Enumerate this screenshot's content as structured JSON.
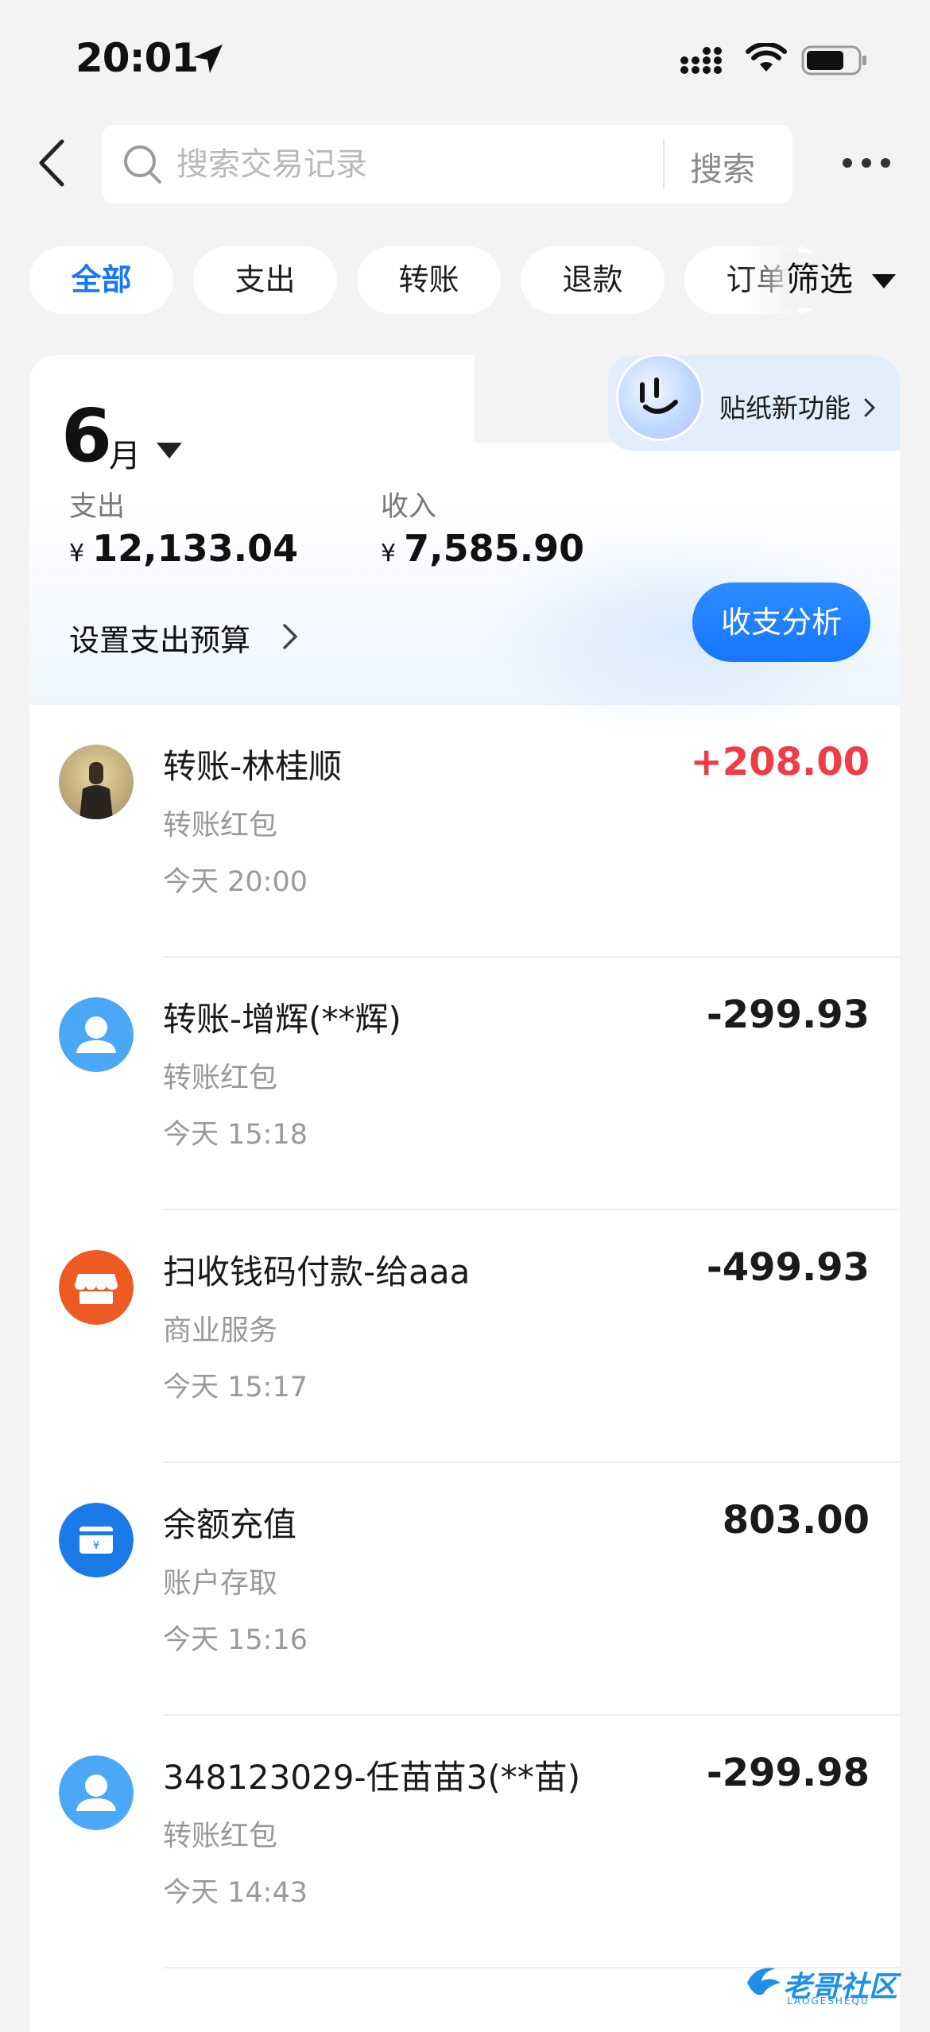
{
  "status_bar": {
    "time": "20:01"
  },
  "search": {
    "placeholder": "搜索交易记录",
    "button_label": "搜索"
  },
  "filters": {
    "chips": [
      {
        "label": "全部",
        "active": true
      },
      {
        "label": "支出",
        "active": false
      },
      {
        "label": "转账",
        "active": false
      },
      {
        "label": "退款",
        "active": false
      },
      {
        "label": "订单",
        "active": false
      }
    ],
    "filter_label": "筛选"
  },
  "summary": {
    "sticker_label": "贴纸新功能",
    "month_number": "6",
    "month_unit": "月",
    "expense_label": "支出",
    "expense_value": "12,133.04",
    "income_label": "收入",
    "income_value": "7,585.90",
    "currency": "¥",
    "budget_link": "设置支出预算",
    "analysis_button": "收支分析"
  },
  "transactions": [
    {
      "title": "转账-林桂顺",
      "category": "转账红包",
      "time": "今天 20:00",
      "amount": "+208.00",
      "icon": "user-photo-avatar"
    },
    {
      "title": "转账-增辉(**辉)",
      "category": "转账红包",
      "time": "今天 15:18",
      "amount": "-299.93",
      "icon": "person-icon"
    },
    {
      "title": "扫收钱码付款-给aaa",
      "category": "商业服务",
      "time": "今天 15:17",
      "amount": "-499.93",
      "icon": "store-icon"
    },
    {
      "title": "余额充值",
      "category": "账户存取",
      "time": "今天 15:16",
      "amount": "803.00",
      "icon": "wallet-icon"
    },
    {
      "title": "348123029-任苗苗3(**苗)",
      "category": "转账红包",
      "time": "今天 14:43",
      "amount": "-299.98",
      "icon": "person-icon"
    }
  ],
  "colors": {
    "accent": "#1677ff",
    "income_red": "#f03c46",
    "background": "#f3f3f3"
  },
  "watermark": {
    "text": "老哥社区",
    "sub": "LAOGESHEQU"
  }
}
